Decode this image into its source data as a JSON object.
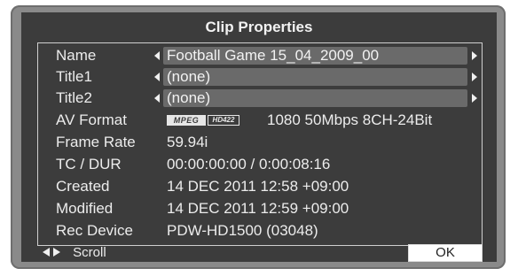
{
  "dialog": {
    "title": "Clip Properties"
  },
  "properties": {
    "name": {
      "label": "Name",
      "value": "Football Game 15_04_2009_00"
    },
    "title1": {
      "label": "Title1",
      "value": "(none)"
    },
    "title2": {
      "label": "Title2",
      "value": "(none)"
    },
    "av_format": {
      "label": "AV Format",
      "logo_mpeg": "MPEG",
      "logo_hd": "HD422",
      "value": "1080 50Mbps 8CH-24Bit"
    },
    "frame_rate": {
      "label": "Frame Rate",
      "value": "59.94i"
    },
    "tc_dur": {
      "label": "TC / DUR",
      "value": "00:00:00:00 / 0:00:08:16"
    },
    "created": {
      "label": "Created",
      "value": "14 DEC 2011 12:58 +09:00"
    },
    "modified": {
      "label": "Modified",
      "value": "14 DEC 2011 12:59 +09:00"
    },
    "rec_device": {
      "label": "Rec Device",
      "value": "PDW-HD1500 (03048)"
    }
  },
  "footer": {
    "scroll_label": "Scroll",
    "ok_label": "OK"
  },
  "icons": {
    "scroll": "left-right-arrows-icon",
    "prev": "triangle-left-icon",
    "next": "triangle-right-icon"
  },
  "colors": {
    "screen_background": "#3c3c3c",
    "field_background": "#6a6a6a",
    "text": "#ececec",
    "bezel": "#8a8a8a"
  }
}
